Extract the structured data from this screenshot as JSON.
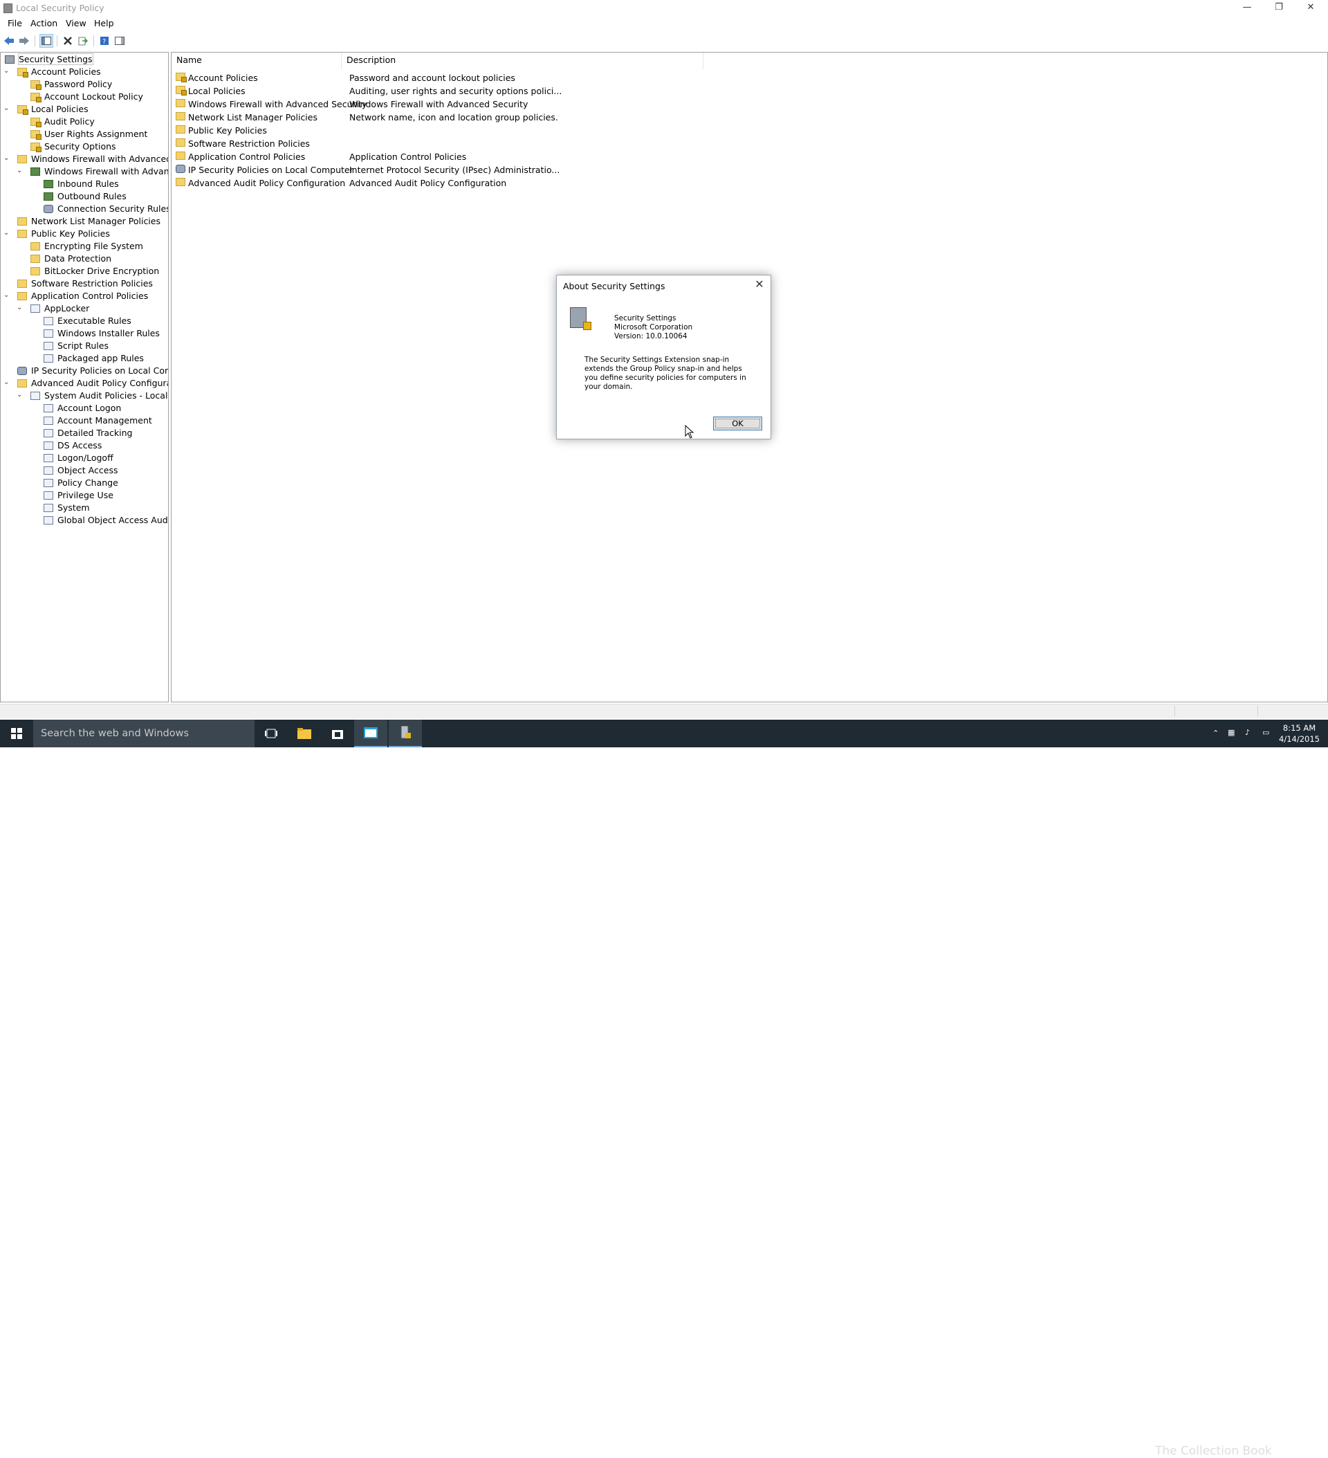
{
  "window": {
    "title": "Local Security Policy",
    "minimize": "—",
    "restore": "❐",
    "close": "✕"
  },
  "menu": [
    "File",
    "Action",
    "View",
    "Help"
  ],
  "tree": {
    "root": "Security Settings",
    "items": [
      {
        "label": "Account Policies",
        "level": 1,
        "icon": "folder-lock",
        "chev": "v"
      },
      {
        "label": "Password Policy",
        "level": 2,
        "icon": "folder-lock"
      },
      {
        "label": "Account Lockout Policy",
        "level": 2,
        "icon": "folder-lock"
      },
      {
        "label": "Local Policies",
        "level": 1,
        "icon": "folder-lock",
        "chev": "v"
      },
      {
        "label": "Audit Policy",
        "level": 2,
        "icon": "folder-lock"
      },
      {
        "label": "User Rights Assignment",
        "level": 2,
        "icon": "folder-lock"
      },
      {
        "label": "Security Options",
        "level": 2,
        "icon": "folder-lock"
      },
      {
        "label": "Windows Firewall with Advanced Secu",
        "level": 1,
        "icon": "folder",
        "chev": "v"
      },
      {
        "label": "Windows Firewall with Advanced",
        "level": 2,
        "icon": "shield",
        "chev": "v"
      },
      {
        "label": "Inbound Rules",
        "level": 3,
        "icon": "shield"
      },
      {
        "label": "Outbound Rules",
        "level": 3,
        "icon": "shield"
      },
      {
        "label": "Connection Security Rules",
        "level": 3,
        "icon": "gear"
      },
      {
        "label": "Network List Manager Policies",
        "level": 1,
        "icon": "folder"
      },
      {
        "label": "Public Key Policies",
        "level": 1,
        "icon": "folder",
        "chev": "v"
      },
      {
        "label": "Encrypting File System",
        "level": 2,
        "icon": "folder"
      },
      {
        "label": "Data Protection",
        "level": 2,
        "icon": "folder"
      },
      {
        "label": "BitLocker Drive Encryption",
        "level": 2,
        "icon": "folder"
      },
      {
        "label": "Software Restriction Policies",
        "level": 1,
        "icon": "folder"
      },
      {
        "label": "Application Control Policies",
        "level": 1,
        "icon": "folder",
        "chev": "v"
      },
      {
        "label": "AppLocker",
        "level": 2,
        "icon": "doc",
        "chev": "v"
      },
      {
        "label": "Executable Rules",
        "level": 3,
        "icon": "doc"
      },
      {
        "label": "Windows Installer Rules",
        "level": 3,
        "icon": "doc"
      },
      {
        "label": "Script Rules",
        "level": 3,
        "icon": "doc"
      },
      {
        "label": "Packaged app Rules",
        "level": 3,
        "icon": "doc"
      },
      {
        "label": "IP Security Policies on Local Compute",
        "level": 1,
        "icon": "gear"
      },
      {
        "label": "Advanced Audit Policy Configuration",
        "level": 1,
        "icon": "folder",
        "chev": "v"
      },
      {
        "label": "System Audit Policies - Local Grou",
        "level": 2,
        "icon": "doc",
        "chev": "v"
      },
      {
        "label": "Account Logon",
        "level": 3,
        "icon": "doc"
      },
      {
        "label": "Account Management",
        "level": 3,
        "icon": "doc"
      },
      {
        "label": "Detailed Tracking",
        "level": 3,
        "icon": "doc"
      },
      {
        "label": "DS Access",
        "level": 3,
        "icon": "doc"
      },
      {
        "label": "Logon/Logoff",
        "level": 3,
        "icon": "doc"
      },
      {
        "label": "Object Access",
        "level": 3,
        "icon": "doc"
      },
      {
        "label": "Policy Change",
        "level": 3,
        "icon": "doc"
      },
      {
        "label": "Privilege Use",
        "level": 3,
        "icon": "doc"
      },
      {
        "label": "System",
        "level": 3,
        "icon": "doc"
      },
      {
        "label": "Global Object Access Auditing",
        "level": 3,
        "icon": "doc"
      }
    ]
  },
  "list": {
    "columns": [
      "Name",
      "Description"
    ],
    "rows": [
      {
        "name": "Account Policies",
        "desc": "Password and account lockout policies",
        "icon": "folder-lock"
      },
      {
        "name": "Local Policies",
        "desc": "Auditing, user rights and security options polici...",
        "icon": "folder-lock"
      },
      {
        "name": "Windows Firewall with Advanced Security",
        "desc": "Windows Firewall with Advanced Security",
        "icon": "folder"
      },
      {
        "name": "Network List Manager Policies",
        "desc": "Network name, icon and location group policies.",
        "icon": "folder"
      },
      {
        "name": "Public Key Policies",
        "desc": "",
        "icon": "folder"
      },
      {
        "name": "Software Restriction Policies",
        "desc": "",
        "icon": "folder"
      },
      {
        "name": "Application Control Policies",
        "desc": "Application Control Policies",
        "icon": "folder"
      },
      {
        "name": "IP Security Policies on Local Computer",
        "desc": "Internet Protocol Security (IPsec) Administratio...",
        "icon": "gear"
      },
      {
        "name": "Advanced Audit Policy Configuration",
        "desc": "Advanced Audit Policy Configuration",
        "icon": "folder"
      }
    ]
  },
  "dialog": {
    "title": "About Security Settings",
    "product": "Security Settings",
    "company": "Microsoft Corporation",
    "version": "Version: 10.0.10064",
    "description": "The Security Settings Extension snap-in extends the Group Policy snap-in and helps you define security policies for computers in your domain.",
    "ok": "OK",
    "close": "✕"
  },
  "taskbar": {
    "search_placeholder": "Search the web and Windows",
    "watermark": "The Collection Book",
    "time": "8:15 AM",
    "date": "4/14/2015"
  }
}
